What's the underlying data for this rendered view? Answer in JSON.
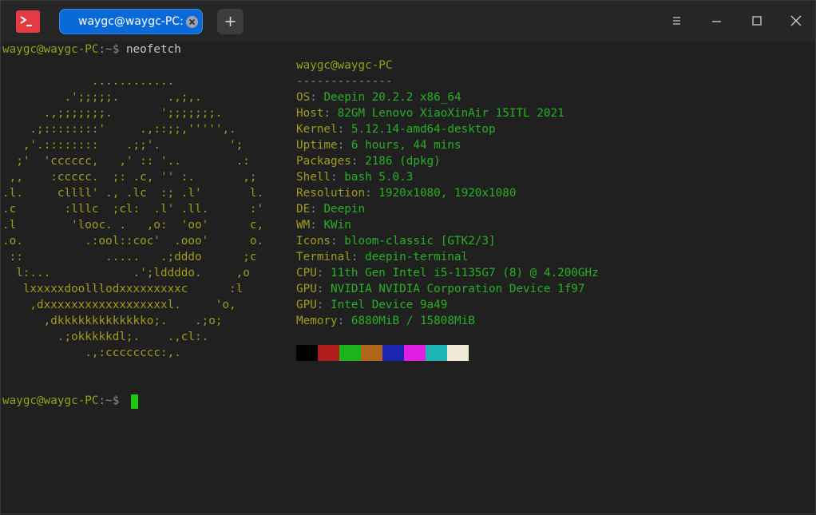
{
  "window": {
    "tab_title": "waygc@waygc-PC: ~"
  },
  "icons": {
    "app": "terminal-icon",
    "tab_close": "close-icon",
    "new_tab": "plus-icon",
    "menu": "menu-icon",
    "minimize": "minimize-icon",
    "maximize": "maximize-icon",
    "close": "close-icon"
  },
  "prompt1": {
    "user": "waygc@waygc-PC",
    "sep": ":~$ ",
    "command": "neofetch"
  },
  "logo_lines": [
    "             ............",
    "         .';;;;;.       .,;,.",
    "      .,;;;;;;;.       ';;;;;;;.",
    "    .;::::::::'     .,::;;,''''',.",
    "   ,'.::::::::    .;;'.          ';",
    "  ;'  'cccccc,   ,' :: '..        .:",
    " ,,    :ccccc.  ;: .c, '' :.       ,;",
    ".l.     cllll' ., .lc  :; .l'       l.",
    ".c       :lllc  ;cl:  .l' .ll.      :'",
    ".l        'looc. .   ,o:  'oo'      c,",
    ".o.         .:ool::coc'  .ooo'      o.",
    " ::            .....   .;dddo      ;c",
    "  l:...            .';lddddo.     ,o",
    "   lxxxxxdoolllodxxxxxxxxxc      :l",
    "    ,dxxxxxxxxxxxxxxxxxxl.     'o,",
    "      ,dkkkkkkkkkkkkko;.    .;o;",
    "        .;okkkkkdl;.    .,cl:.",
    "            .,:cccccccc:,."
  ],
  "info": {
    "title": "waygc@waygc-PC",
    "separator": "--------------",
    "rows": [
      {
        "key": "OS",
        "value": "Deepin 20.2.2 x86_64"
      },
      {
        "key": "Host",
        "value": "82GM Lenovo XiaoXinAir 15ITL 2021"
      },
      {
        "key": "Kernel",
        "value": "5.12.14-amd64-desktop"
      },
      {
        "key": "Uptime",
        "value": "6 hours, 44 mins"
      },
      {
        "key": "Packages",
        "value": "2186 (dpkg)"
      },
      {
        "key": "Shell",
        "value": "bash 5.0.3"
      },
      {
        "key": "Resolution",
        "value": "1920x1080, 1920x1080"
      },
      {
        "key": "DE",
        "value": "Deepin"
      },
      {
        "key": "WM",
        "value": "KWin"
      },
      {
        "key": "Icons",
        "value": "bloom-classic [GTK2/3]"
      },
      {
        "key": "Terminal",
        "value": "deepin-terminal"
      },
      {
        "key": "CPU",
        "value": "11th Gen Intel i5-1135G7 (8) @ 4.200GHz"
      },
      {
        "key": "GPU",
        "value": "NVIDIA NVIDIA Corporation Device 1f97"
      },
      {
        "key": "GPU",
        "value": "Intel Device 9a49"
      },
      {
        "key": "Memory",
        "value": "6880MiB / 15808MiB"
      }
    ],
    "key_separator": ": "
  },
  "palette": [
    "#000000",
    "#b01d1d",
    "#1cb41c",
    "#b0641c",
    "#1c24b0",
    "#e21ee2",
    "#1cb4b4",
    "#f0ead7"
  ],
  "prompt2": {
    "user": "waygc@waygc-PC",
    "sep": ":~$ "
  }
}
